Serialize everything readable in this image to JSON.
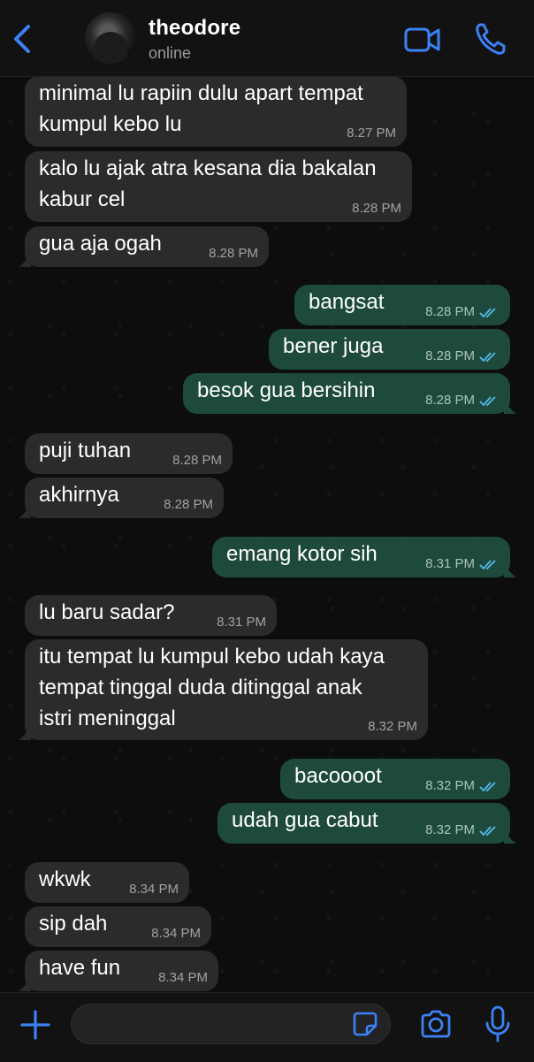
{
  "header": {
    "contact_name": "theodore",
    "status": "online"
  },
  "colors": {
    "accent": "#3b82f6",
    "incoming_bubble": "#2b2b2d",
    "outgoing_bubble": "#1e4a3e",
    "read_ticks": "#53bdeb"
  },
  "messages": [
    {
      "dir": "in",
      "text": "minimal lu rapiin dulu apart tempat kumpul kebo lu",
      "time": "8.27 PM"
    },
    {
      "dir": "in",
      "text": "kalo lu ajak atra kesana dia bakalan kabur cel",
      "time": "8.28 PM"
    },
    {
      "dir": "in",
      "text": "gua aja ogah",
      "time": "8.28 PM"
    },
    {
      "dir": "out",
      "text": "bangsat",
      "time": "8.28 PM"
    },
    {
      "dir": "out",
      "text": "bener juga",
      "time": "8.28 PM"
    },
    {
      "dir": "out",
      "text": "besok gua bersihin",
      "time": "8.28 PM"
    },
    {
      "dir": "in",
      "text": "puji tuhan",
      "time": "8.28 PM"
    },
    {
      "dir": "in",
      "text": "akhirnya",
      "time": "8.28 PM"
    },
    {
      "dir": "out",
      "text": "emang kotor sih",
      "time": "8.31 PM"
    },
    {
      "dir": "in",
      "text": "lu baru sadar?",
      "time": "8.31 PM"
    },
    {
      "dir": "in",
      "text": "itu tempat lu kumpul kebo udah kaya tempat tinggal duda ditinggal anak istri meninggal",
      "time": "8.32 PM"
    },
    {
      "dir": "out",
      "text": "bacoooot",
      "time": "8.32 PM"
    },
    {
      "dir": "out",
      "text": "udah gua cabut",
      "time": "8.32 PM"
    },
    {
      "dir": "in",
      "text": "wkwk",
      "time": "8.34 PM"
    },
    {
      "dir": "in",
      "text": "sip dah",
      "time": "8.34 PM"
    },
    {
      "dir": "in",
      "text": "have fun",
      "time": "8.34 PM"
    }
  ],
  "composer": {
    "value": "",
    "placeholder": ""
  },
  "icons": {
    "back": "chevron-left-icon",
    "video": "video-camera-icon",
    "phone": "phone-icon",
    "plus": "plus-icon",
    "sticker": "sticker-icon",
    "camera": "camera-icon",
    "mic": "microphone-icon",
    "read_status": "double-check-icon"
  }
}
